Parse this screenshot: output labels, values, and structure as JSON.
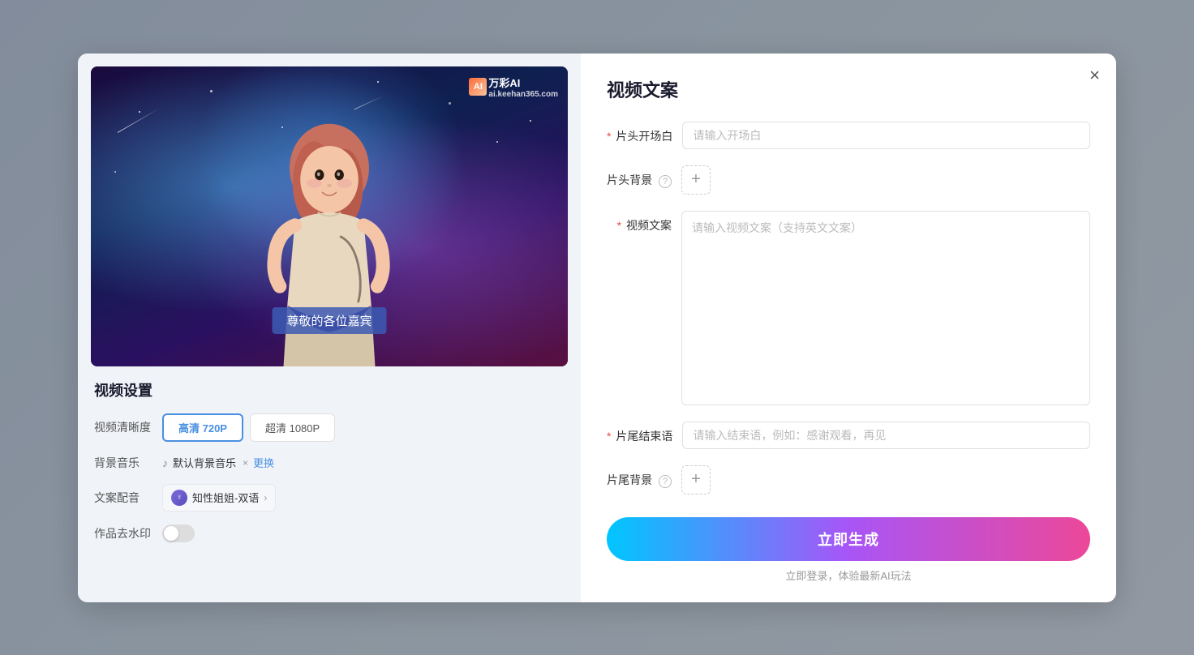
{
  "modal": {
    "close_label": "×",
    "left": {
      "watermark_text": "万彩AI",
      "watermark_sub": "ai.keehan365.com",
      "subtitle": "尊敬的各位嘉宾",
      "settings_title": "视频设置",
      "quality_label": "视频清晰度",
      "quality_options": [
        {
          "label": "高清 720P",
          "active": true
        },
        {
          "label": "超清 1080P",
          "active": false
        }
      ],
      "music_label": "背景音乐",
      "music_name": "默认背景音乐",
      "music_change": "更换",
      "voice_label": "文案配音",
      "voice_name": "知性姐姐-双语",
      "watermark_label": "作品去水印",
      "toggle_on": false
    },
    "right": {
      "title": "视频文案",
      "fields": [
        {
          "label": "片头开场白",
          "required": true,
          "type": "input",
          "placeholder": "请输入开场白"
        },
        {
          "label": "片头背景",
          "required": false,
          "has_help": true,
          "type": "add"
        },
        {
          "label": "视频文案",
          "required": true,
          "type": "textarea",
          "placeholder": "请输入视频文案（支持英文文案）"
        },
        {
          "label": "片尾结束语",
          "required": true,
          "type": "input",
          "placeholder": "请输入结束语，例如：感谢观看，再见"
        },
        {
          "label": "片尾背景",
          "required": false,
          "has_help": true,
          "type": "add"
        }
      ],
      "generate_btn": "立即生成",
      "login_hint": "立即登录，体验最新AI玩法"
    }
  }
}
